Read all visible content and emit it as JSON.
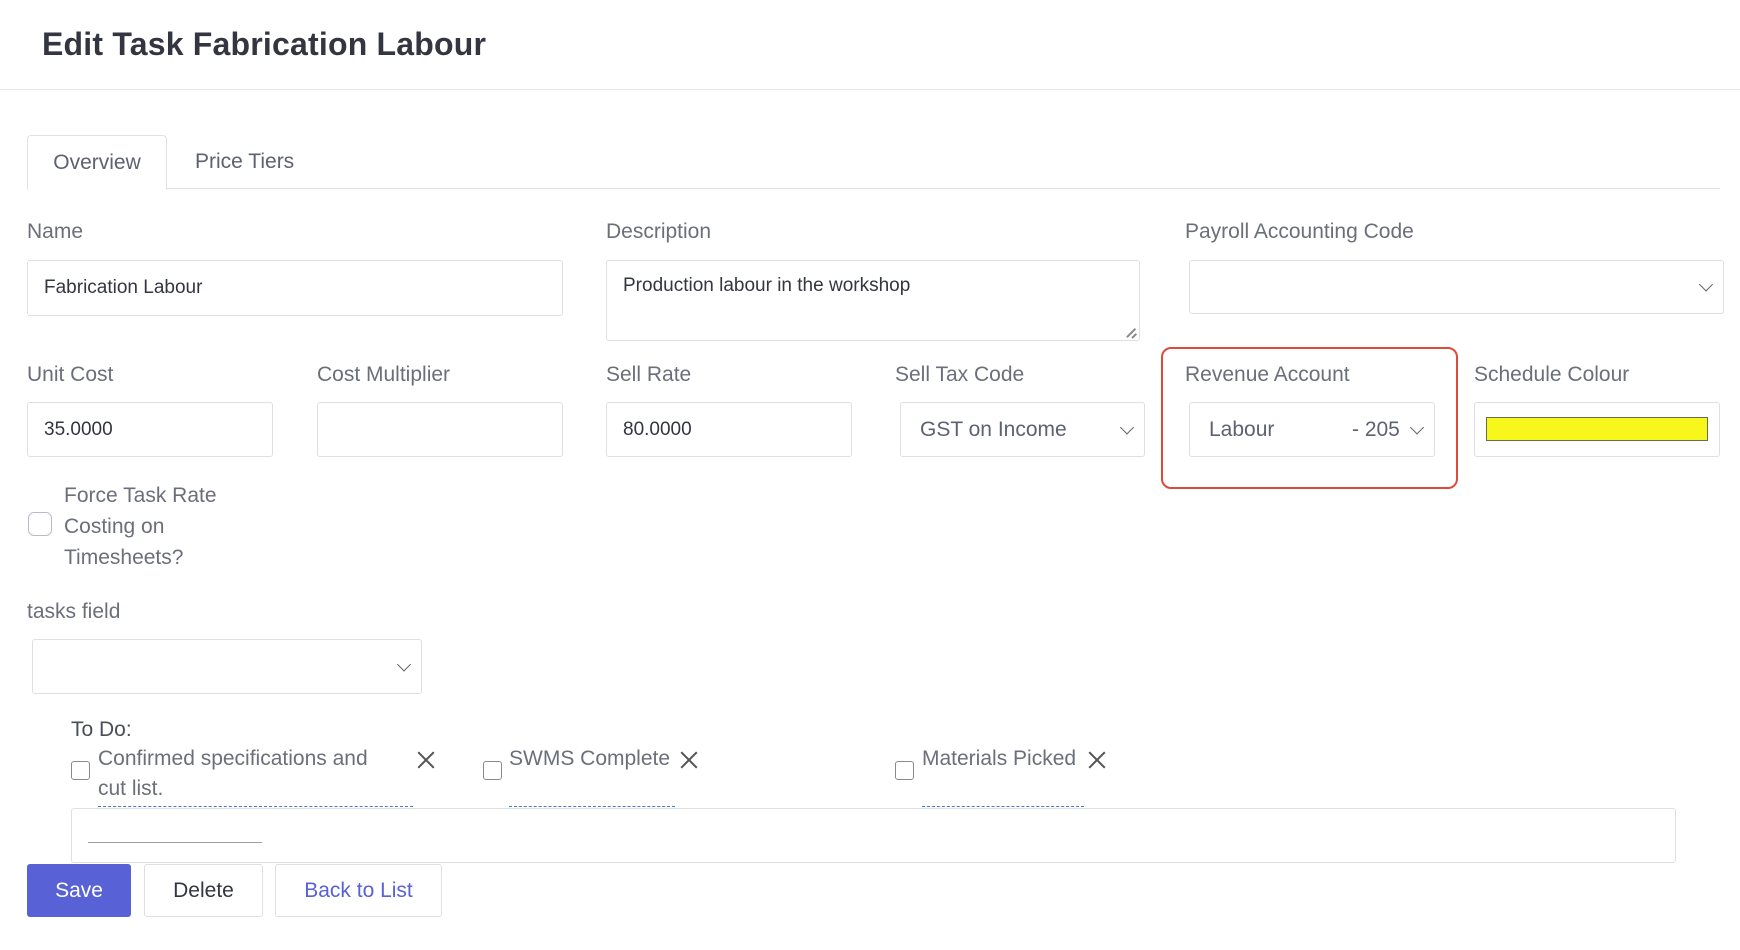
{
  "page": {
    "title": "Edit Task Fabrication Labour"
  },
  "tabs": [
    {
      "label": "Overview",
      "active": true
    },
    {
      "label": "Price Tiers",
      "active": false
    }
  ],
  "form": {
    "name": {
      "label": "Name",
      "value": "Fabrication Labour"
    },
    "description": {
      "label": "Description",
      "value": "Production labour in the workshop"
    },
    "payroll_code": {
      "label": "Payroll Accounting Code",
      "value": ""
    },
    "unit_cost": {
      "label": "Unit Cost",
      "value": "35.0000"
    },
    "cost_multiplier": {
      "label": "Cost Multiplier",
      "value": ""
    },
    "sell_rate": {
      "label": "Sell Rate",
      "value": "80.0000"
    },
    "sell_tax_code": {
      "label": "Sell Tax Code",
      "value": "GST on Income"
    },
    "revenue_account": {
      "label": "Revenue Account",
      "value_name": "Labour",
      "value_code": "- 205"
    },
    "schedule_colour": {
      "label": "Schedule Colour",
      "value": "#f7f71c"
    },
    "force_task_rate": {
      "label_line1": "Force Task Rate",
      "label_line2": "Costing on",
      "label_line3": "Timesheets?",
      "checked": false
    },
    "tasks_field": {
      "label": "tasks field",
      "value": ""
    }
  },
  "todo": {
    "heading": "To Do:",
    "items": [
      {
        "line1": "Confirmed specifications and",
        "line2": "cut list.",
        "checked": false
      },
      {
        "line1": "SWMS Complete",
        "checked": false
      },
      {
        "line1": "Materials Picked",
        "checked": false
      }
    ]
  },
  "buttons": {
    "save": "Save",
    "delete": "Delete",
    "back": "Back to List"
  },
  "colors": {
    "accent": "#5961d6",
    "highlight": "#dd4b3a",
    "schedule": "#f7f71c"
  }
}
